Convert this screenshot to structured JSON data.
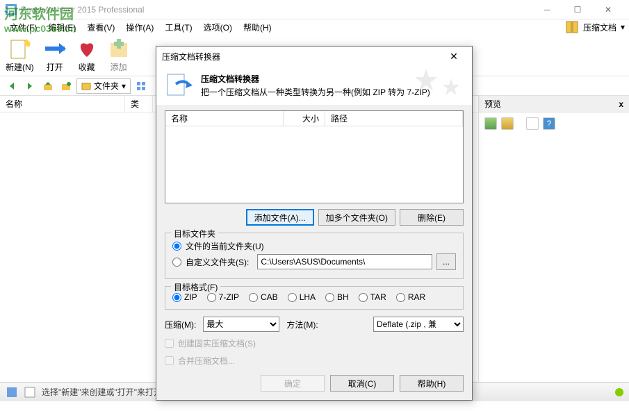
{
  "window": {
    "title": "PowerArchiver 2015 Professional"
  },
  "menus": [
    "文件(F)",
    "编辑(E)",
    "查看(V)",
    "操作(A)",
    "工具(T)",
    "选项(O)",
    "帮助(H)"
  ],
  "rightDoc": {
    "label": "压缩文档",
    "chevron": "▾"
  },
  "tool_buttons": {
    "new": "新建(N)",
    "open": "打开",
    "fav": "收藏",
    "add": "添加"
  },
  "nav": {
    "folders": "文件夹"
  },
  "list_cols": {
    "name": "名称",
    "type": "类"
  },
  "preview": {
    "title": "预览",
    "close": "x"
  },
  "status": {
    "msg": "选择\"新建\"来创建或\"打开\"来打开一个压缩文档。"
  },
  "watermark": {
    "site": "河东软件园",
    "url": "www.pc0359.cn"
  },
  "dialog": {
    "title": "压缩文档转换器",
    "head_title": "压缩文档转换器",
    "head_desc": "把一个压缩文档从一种类型转换为另一种(例如 ZIP 转为 7-ZIP)",
    "cols": {
      "name": "名称",
      "size": "大小",
      "path": "路径"
    },
    "btn_add": "添加文件(A)...",
    "btn_addfolders": "加多个文件夹(O)",
    "btn_delete": "删除(E)",
    "target_group": "目标文件夹",
    "radio_current": "文件的当前文件夹(U)",
    "radio_custom": "自定义文件夹(S):",
    "custom_path": "C:\\Users\\ASUS\\Documents\\",
    "browse": "...",
    "format_group": "目标格式(F)",
    "formats": [
      "ZIP",
      "7-ZIP",
      "CAB",
      "LHA",
      "BH",
      "TAR",
      "RAR"
    ],
    "compress_label": "压缩(M):",
    "compress_value": "最大",
    "method_label": "方法(M):",
    "method_value": "Deflate (.zip , 兼",
    "chk_solid": "创建固实压缩文档(S)",
    "chk_merge": "合并压缩文档...",
    "ok": "确定",
    "cancel": "取消(C)",
    "help": "帮助(H)"
  }
}
